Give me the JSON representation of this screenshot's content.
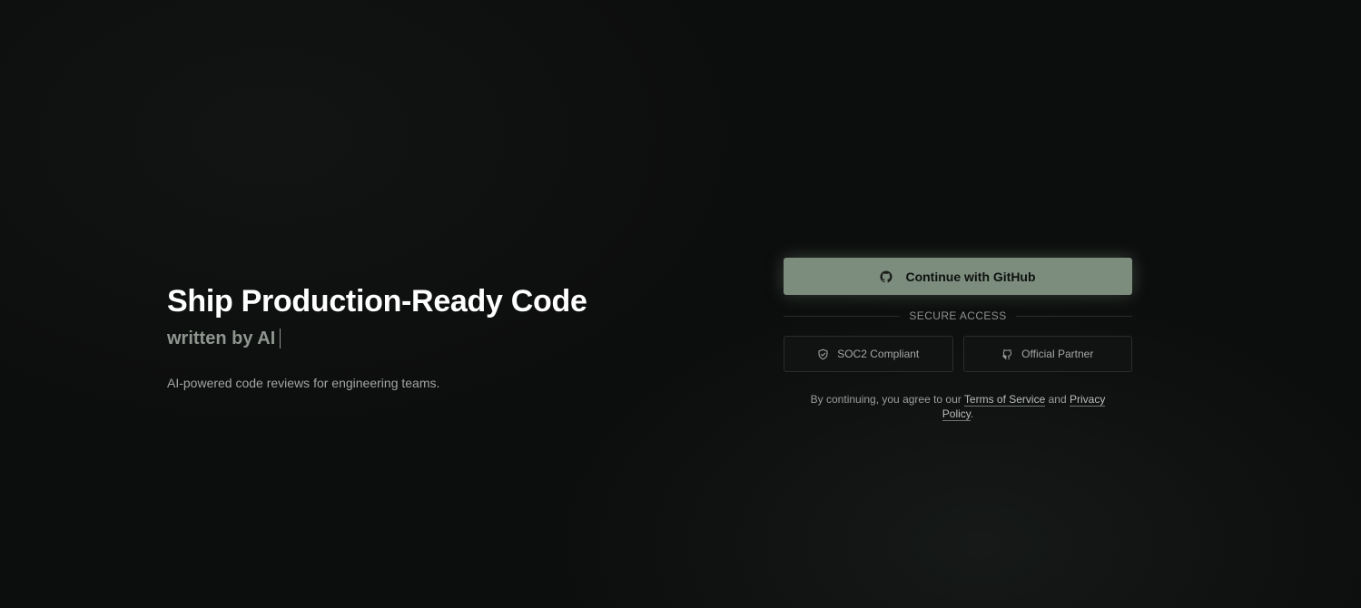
{
  "hero": {
    "title": "Ship Production-Ready Code",
    "subtitle": "written by AI",
    "description": "AI-powered code reviews for engineering teams."
  },
  "auth": {
    "github_button": {
      "label": "Continue with GitHub",
      "icon": "github-icon"
    },
    "divider_label": "SECURE ACCESS",
    "badges": [
      {
        "label": "SOC2 Compliant",
        "icon": "shield-check-icon"
      },
      {
        "label": "Official Partner",
        "icon": "github-icon"
      }
    ],
    "legal": {
      "prefix": "By continuing, you agree to our",
      "terms_link": "Terms of Service",
      "conjunction": "and",
      "privacy_link": "Privacy Policy",
      "suffix": "."
    }
  },
  "colors": {
    "background": "#0c0d0d",
    "primary_button": "#7c8d7d",
    "subtitle_text": "#8f958f"
  }
}
